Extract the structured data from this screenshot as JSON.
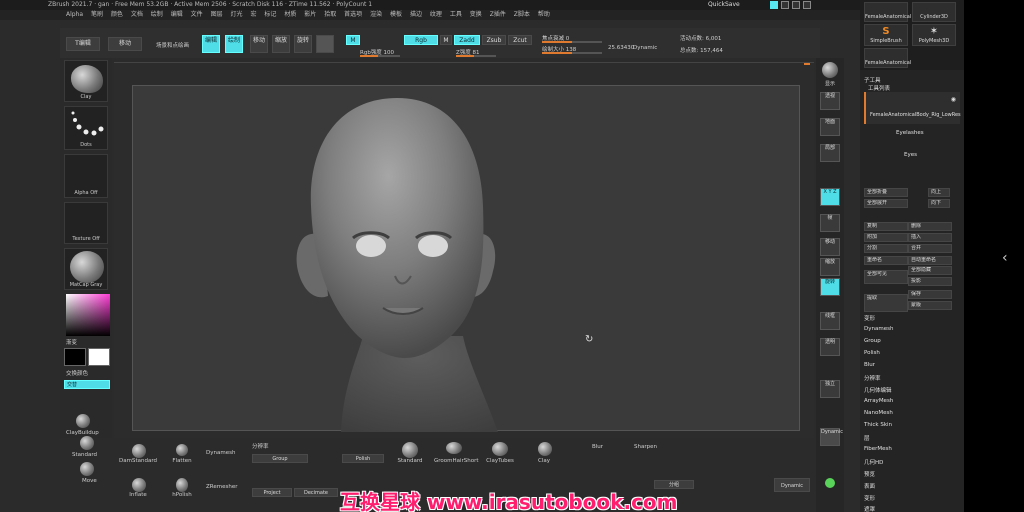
{
  "titlebar": {
    "text": "ZBrush 2021.7 · gan · Free Mem 53.2GB · Active Mem 2506 · Scratch Disk 116 · ZTime 11.562 · PolyCount 1",
    "quicksave": "QuickSave"
  },
  "menubar": {
    "items": [
      "Alpha",
      "笔刷",
      "颜色",
      "文档",
      "绘制",
      "编辑",
      "文件",
      "图层",
      "灯光",
      "宏",
      "标记",
      "材质",
      "影片",
      "拾取",
      "首选项",
      "渲染",
      "模板",
      "描边",
      "纹理",
      "工具",
      "变换",
      "Z插件",
      "Z脚本",
      "帮助"
    ]
  },
  "toolbar": {
    "buttons": [
      "T编辑",
      "移动",
      "编辑",
      "绘制",
      "移动",
      "缩放",
      "旋转"
    ],
    "home_label": "场景和点绘画",
    "mrgb": "M",
    "rgb": "Rgb",
    "m": "M",
    "zadd": "Zadd",
    "zsub": "Zsub",
    "zcut": "Zcut",
    "focal_label": "焦点衰减 0",
    "draw_size_label": "绘制大小 138",
    "rgb_intensity": "Rgb强度 100",
    "z_intensity": "Z强度 81",
    "dynamic": "Dynamic",
    "active_points": "活动点数: 6,001",
    "total_points": "总点数: 157,464",
    "zoom_value": "25.63430",
    "intensity_fill": 0.45,
    "size_fill": 0.5,
    "focal_fill": 0.5
  },
  "leftshelf": {
    "brush": "Clay",
    "stroke": "Dots",
    "alpha": "Alpha Off",
    "texture": "Texture Off",
    "material": "MatCap Gray",
    "gradient_label": "渐变",
    "switch_label": "交换颜色",
    "alt_label": "交替"
  },
  "sidebar": {
    "items": [
      "显示",
      "透视",
      "地面",
      "局部",
      "X Y Z",
      "帧",
      "移动",
      "缩放",
      "旋转",
      "线框",
      "透明",
      "独立",
      "Dynamic"
    ]
  },
  "tray": {
    "tools": [
      "FemaleAnatomical",
      "Cylinder3D",
      "SimpleBrush",
      "PolyMesh3D",
      "FemaleAnatomical"
    ],
    "subtool_label": "子工具",
    "list_label": "工具列表",
    "subtools": [
      "FemaleAnatomicalBody_Rig_LowRes",
      "Eyelashes",
      "Eyes"
    ],
    "buttons": [
      "全部折叠",
      "全部展开",
      "向上",
      "向下",
      "复制",
      "删除",
      "附加",
      "插入",
      "分割",
      "合并",
      "重命名",
      "自动重命名",
      "全部可见",
      "全部隐藏",
      "投影",
      "提取",
      "保存",
      "蒙版",
      "变形"
    ],
    "sections": [
      "几何体编辑",
      "ArrayMesh",
      "NanoMesh",
      "Thick Skin",
      "层",
      "FiberMesh",
      "几何HD",
      "预览",
      "表面",
      "变形",
      "遮罩"
    ]
  },
  "bottom": {
    "brushes": [
      "DamStandard",
      "Flatten",
      "ClayBuildup",
      "Standard",
      "Move",
      "hPolish",
      "Inflate",
      "Smooth",
      "GroomHairShort",
      "ClayTubes",
      "Clay"
    ],
    "labels": [
      "Dynamesh",
      "Group",
      "Polish",
      "Blur",
      "分辨率",
      "Sharpen",
      "ZRemesher",
      "Project",
      "Decimate",
      "分组",
      "Dynamic"
    ],
    "watermark": "互换星球 www.irasutobook.com"
  }
}
